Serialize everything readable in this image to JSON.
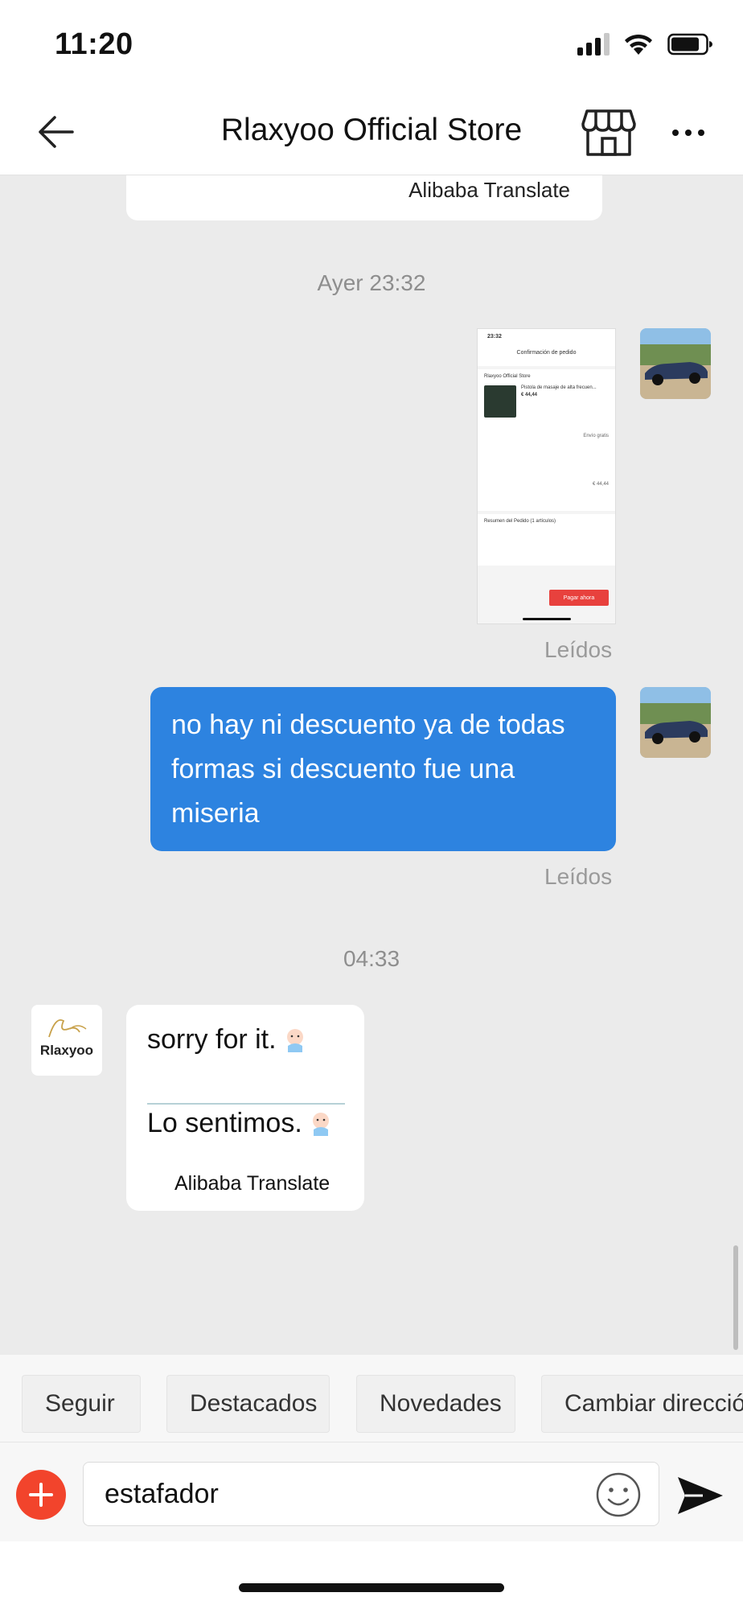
{
  "status_bar": {
    "time": "11:20",
    "icons": [
      "signal-icon",
      "wifi-icon",
      "battery-icon"
    ]
  },
  "header": {
    "title": "Rlaxyoo Official Store",
    "icons": [
      "back-arrow-icon",
      "store-icon",
      "more-icon"
    ]
  },
  "chat": {
    "previous_caption": "Alibaba Translate",
    "timestamp_1": "Ayer 23:32",
    "screenshot_message": {
      "mini_time": "23:32",
      "mini_title": "Confirmación de pedido",
      "mini_store": "Rlaxyoo Official Store",
      "mini_product": "Pistola de masaje de alta frecuen...",
      "mini_price": "€ 44,44",
      "mini_shipping": "Envío gratis",
      "mini_summary": "Resumen del Pedido (1 artículos)",
      "mini_total": "€ 44,44",
      "mini_pay": "Pagar ahora"
    },
    "read_1": "Leídos",
    "user_message": "no hay ni descuento ya de todas formas si descuento fue una miseria",
    "read_2": "Leídos",
    "timestamp_2": "04:33",
    "store_message": {
      "original": "sorry for it.",
      "translation": "Lo sentimos.",
      "caption": "Alibaba Translate"
    },
    "store_logo_text": "Rlaxyoo"
  },
  "quick_replies": [
    "Seguir",
    "Destacados",
    "Novedades",
    "Cambiar direcció"
  ],
  "input": {
    "value": "estafador"
  },
  "colors": {
    "bubble_out": "#2d83e0",
    "add_button": "#f2442c",
    "background": "#ebebeb"
  }
}
